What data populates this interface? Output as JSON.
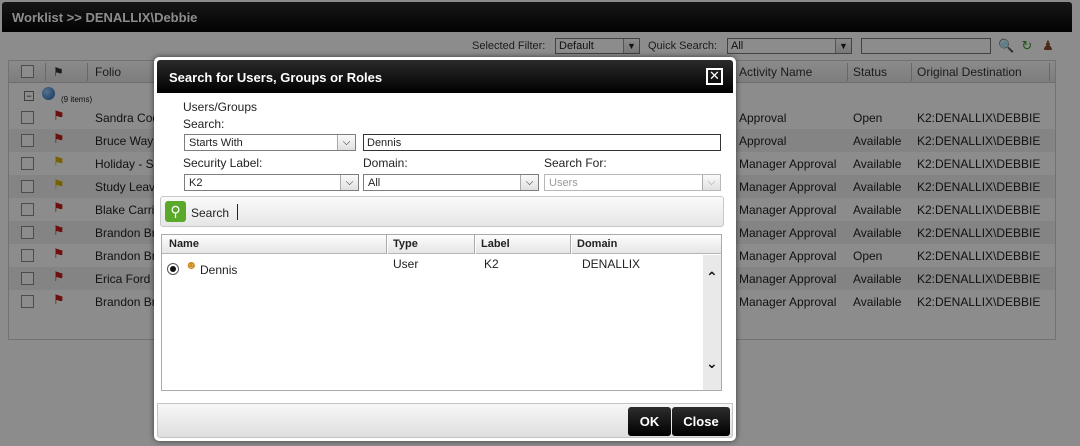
{
  "worklist": {
    "title": "Worklist >> DENALLIX\\Debbie",
    "selected_filter_label": "Selected Filter:",
    "selected_filter_value": "Default",
    "quick_search_label": "Quick Search:",
    "quick_search_value": "All",
    "columns": {
      "folio": "Folio",
      "activity": "Activity Name",
      "status": "Status",
      "destination": "Original Destination"
    },
    "group_count": "(9 items)",
    "rows": [
      {
        "folio": "Sandra Coo",
        "activity": "Approval",
        "status": "Open",
        "destination": "K2:DENALLIX\\DEBBIE",
        "flag": "red"
      },
      {
        "folio": "Bruce Wayn",
        "activity": "Approval",
        "status": "Available",
        "destination": "K2:DENALLIX\\DEBBIE",
        "flag": "red"
      },
      {
        "folio": "Holiday - Su",
        "activity": "Manager Approval",
        "status": "Available",
        "destination": "K2:DENALLIX\\DEBBIE",
        "flag": "yellow"
      },
      {
        "folio": "Study Leave",
        "activity": "Manager Approval",
        "status": "Available",
        "destination": "K2:DENALLIX\\DEBBIE",
        "flag": "yellow"
      },
      {
        "folio": "Blake Carrig",
        "activity": "Manager Approval",
        "status": "Available",
        "destination": "K2:DENALLIX\\DEBBIE",
        "flag": "red"
      },
      {
        "folio": "Brandon Bro",
        "activity": "Manager Approval",
        "status": "Available",
        "destination": "K2:DENALLIX\\DEBBIE",
        "flag": "red"
      },
      {
        "folio": "Brandon Bro",
        "activity": "Manager Approval",
        "status": "Open",
        "destination": "K2:DENALLIX\\DEBBIE",
        "flag": "red"
      },
      {
        "folio": "Erica Ford",
        "activity": "Manager Approval",
        "status": "Available",
        "destination": "K2:DENALLIX\\DEBBIE",
        "flag": "red"
      },
      {
        "folio": "Brandon Bro",
        "activity": "Manager Approval",
        "status": "Available",
        "destination": "K2:DENALLIX\\DEBBIE",
        "flag": "red"
      }
    ]
  },
  "dialog": {
    "title": "Search for Users, Groups or Roles",
    "section_label": "Users/Groups",
    "search_label": "Search:",
    "search_mode": "Starts With",
    "search_value": "Dennis",
    "security_label_label": "Security Label:",
    "security_label_value": "K2",
    "domain_label": "Domain:",
    "domain_value": "All",
    "search_for_label": "Search For:",
    "search_for_value": "Users",
    "search_button": "Search",
    "result_columns": {
      "name": "Name",
      "type": "Type",
      "label": "Label",
      "domain": "Domain"
    },
    "results": [
      {
        "name": "Dennis",
        "type": "User",
        "label": "K2",
        "domain": "DENALLIX"
      }
    ],
    "ok_button": "OK",
    "close_button": "Close"
  },
  "colors": {
    "flag_red": "#c81e1e",
    "flag_yellow": "#d8b200",
    "search_green": "#5aa92a"
  }
}
